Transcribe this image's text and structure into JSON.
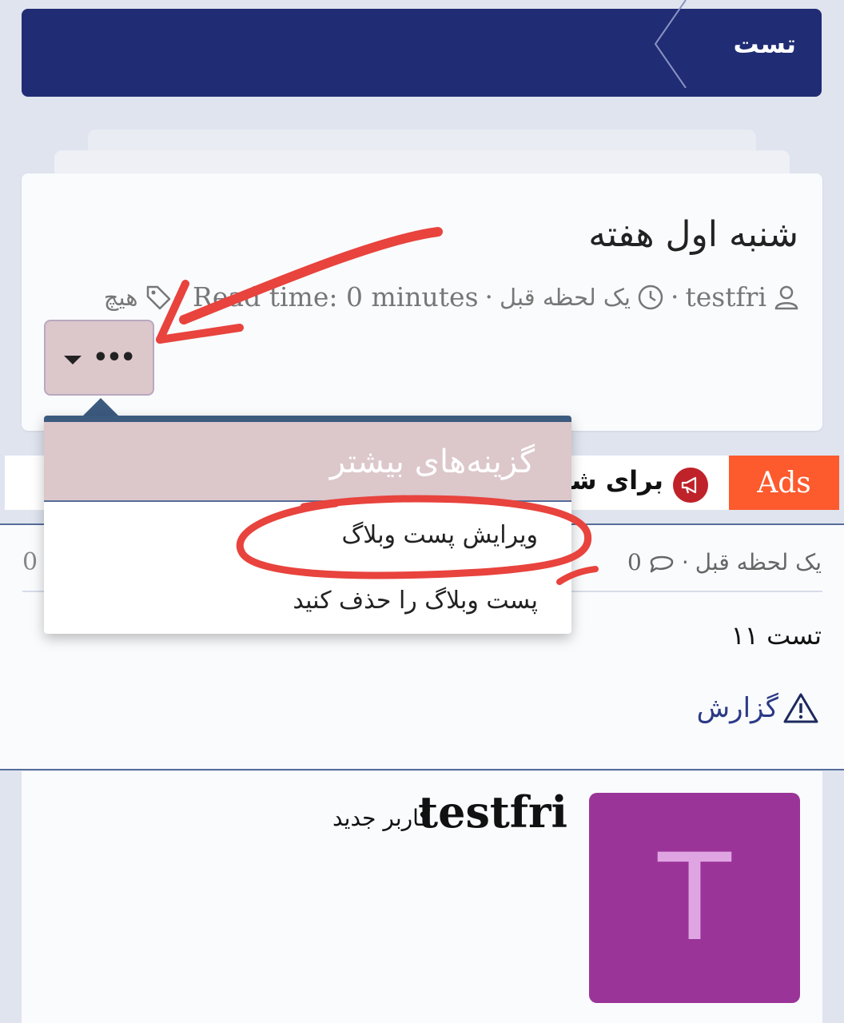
{
  "breadcrumb": {
    "label": "تست"
  },
  "post": {
    "title": "شنبه اول هفته",
    "author": "testfri",
    "time_ago": "یک لحظه قبل",
    "read_time": "Read time: 0 minutes",
    "tags": "هیچ",
    "separator": "·",
    "more_button_label": "•••"
  },
  "dropdown": {
    "header": "گزینه‌های بیشتر",
    "items": [
      {
        "label": "ویرایش پست وبلاگ"
      },
      {
        "label": "پست وبلاگ را حذف کنید"
      }
    ]
  },
  "ads": {
    "badge": "Ads",
    "text": "برای شما"
  },
  "comment": {
    "time_ago": "یک لحظه قبل",
    "count": "0",
    "left_count": "0",
    "body": "تست ۱۱",
    "report_label": "گزارش"
  },
  "author_card": {
    "name": "testfri",
    "role": "کاربر جدید",
    "avatar_letter": "T"
  },
  "colors": {
    "header_bg": "#202c74",
    "ads_badge": "#fd5a2d",
    "avatar_bg": "#9b3498",
    "annotation": "#e8433d"
  },
  "icons": [
    "chevron-left-icon",
    "user-icon",
    "clock-icon",
    "tag-icon",
    "megaphone-icon",
    "comment-icon",
    "warning-icon",
    "caret-down-icon"
  ]
}
